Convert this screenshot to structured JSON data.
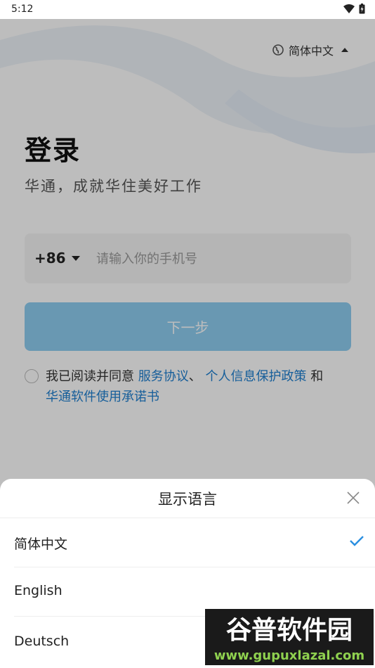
{
  "status_bar": {
    "time": "5:12"
  },
  "login": {
    "language_current": "简体中文",
    "title": "登录",
    "subtitle": "华通，成就华住美好工作",
    "country_code": "+86",
    "phone_placeholder": "请输入你的手机号",
    "next_label": "下一步",
    "agreement": {
      "prefix": "我已阅读并同意 ",
      "service_link": "服务协议",
      "separator": "、 ",
      "privacy_link": "个人信息保护政策",
      "and": " 和",
      "commitment_link": "华通软件使用承诺书"
    }
  },
  "language_sheet": {
    "title": "显示语言",
    "options": [
      {
        "label": "简体中文",
        "selected": true
      },
      {
        "label": "English",
        "selected": false
      },
      {
        "label": "Deutsch",
        "selected": false
      }
    ]
  },
  "watermark": {
    "brand": "谷普软件园",
    "url": "www.gupuxlazal.com"
  },
  "colors": {
    "accent": "#1e7fd0",
    "button_disabled": "#8ecdf1",
    "check": "#2a8fe0"
  }
}
